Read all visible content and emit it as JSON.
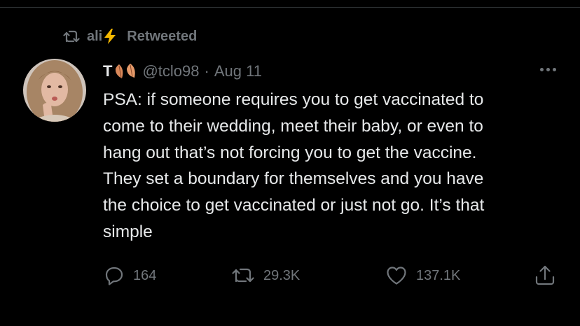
{
  "retweet_banner": {
    "retweeter_name": "ali",
    "retweeter_emoji": "⚡",
    "label": "Retweeted",
    "icon": "retweet-icon"
  },
  "tweet": {
    "author_name": "T",
    "author_name_emoji": "two-autumn-leaves",
    "handle": "@tclo98",
    "separator": "·",
    "date": "Aug 11",
    "text_lines": [
      "PSA: if someone requires you to get vaccinated to",
      "come to their wedding, meet their baby, or even to",
      "hang out that’s not forcing you to get the vaccine.",
      "They set a boundary for themselves and you have",
      "the choice to get vaccinated or just not go. It’s that",
      "simple"
    ]
  },
  "actions": {
    "reply": {
      "icon": "reply-icon",
      "count": "164"
    },
    "retweet": {
      "icon": "retweet-icon",
      "count": "29.3K"
    },
    "like": {
      "icon": "heart-icon",
      "count": "137.1K"
    },
    "share": {
      "icon": "share-icon"
    }
  },
  "colors": {
    "background": "#000000",
    "text_primary": "#e7e9ea",
    "text_secondary": "#71767b",
    "bolt": "#f5b800",
    "leaf": "#d9885a"
  }
}
